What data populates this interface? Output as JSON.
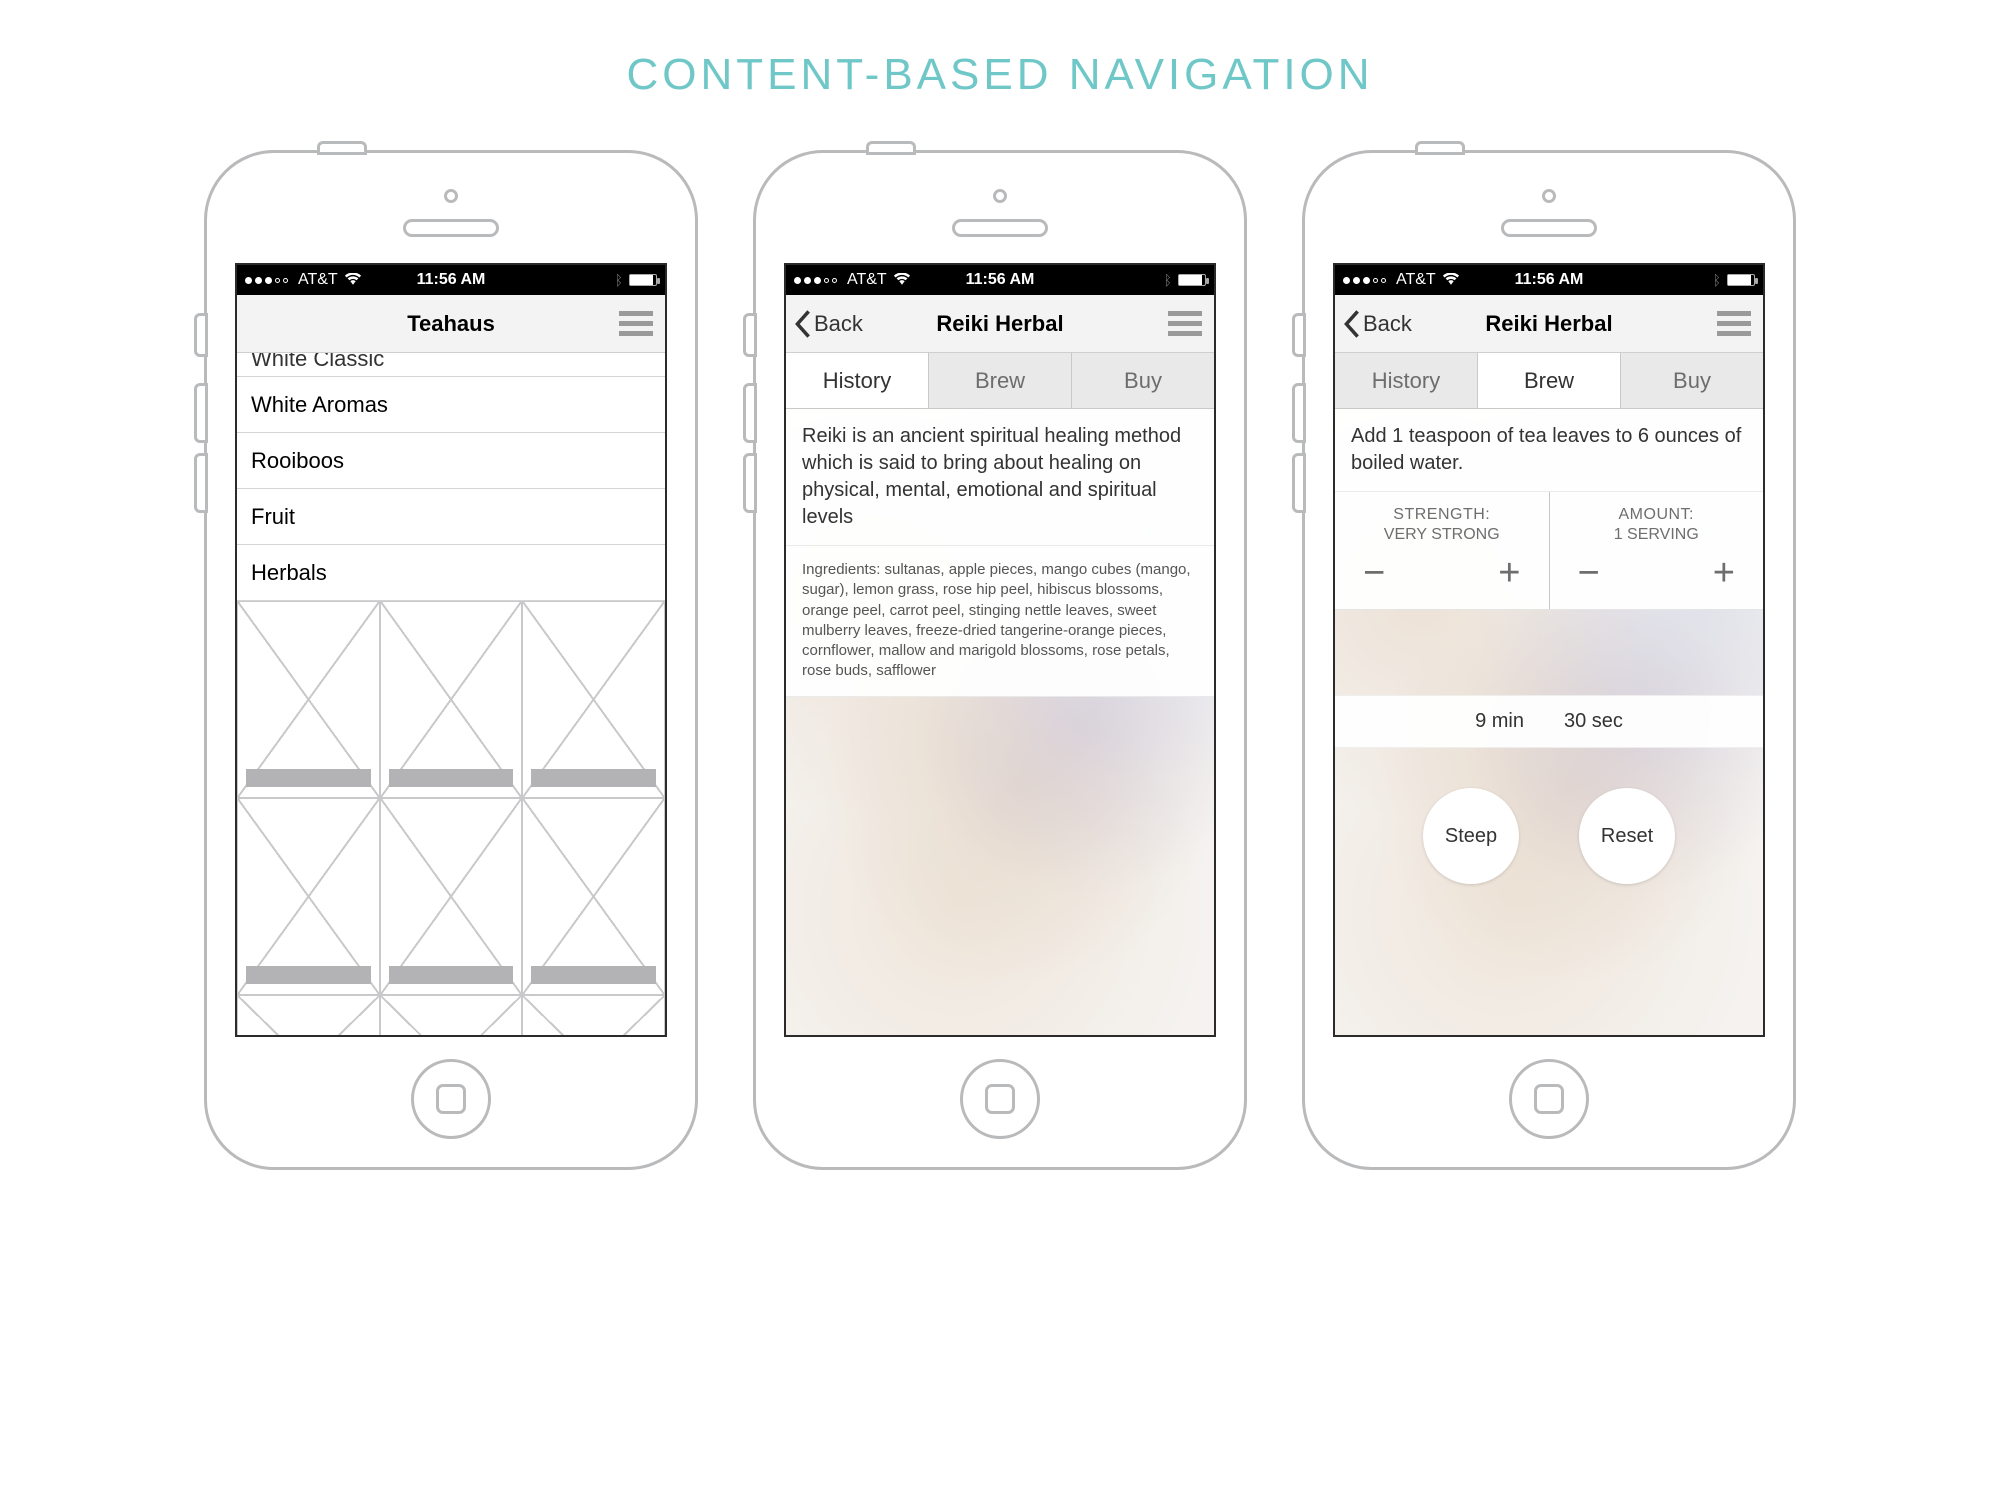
{
  "page_heading": "CONTENT-BASED NAVIGATION",
  "status": {
    "carrier": "AT&T",
    "time": "11:56 AM"
  },
  "phone1": {
    "title": "Teahaus",
    "list": {
      "partial_top": "White Classic",
      "items": [
        "White Aromas",
        "Rooiboos",
        "Fruit",
        "Herbals"
      ]
    }
  },
  "phone2": {
    "back_label": "Back",
    "title": "Reiki Herbal",
    "tabs": {
      "history": "History",
      "brew": "Brew",
      "buy": "Buy",
      "active": "history"
    },
    "description": "Reiki is an ancient spiritual healing method which is said to bring about healing on physical, mental, emotional and spiritual levels",
    "ingredients": "Ingredients: sultanas, apple pieces, mango cubes (mango, sugar), lemon grass, rose hip peel, hibiscus blossoms, orange peel, carrot peel, stinging nettle leaves, sweet mulberry leaves, freeze-dried tangerine-orange pieces, cornflower, mallow and marigold blossoms, rose petals, rose buds, safflower"
  },
  "phone3": {
    "back_label": "Back",
    "title": "Reiki Herbal",
    "tabs": {
      "history": "History",
      "brew": "Brew",
      "buy": "Buy",
      "active": "brew"
    },
    "instruction": "Add 1 teaspoon of tea leaves to 6 ounces of boiled water.",
    "strength": {
      "label": "STRENGTH:",
      "value": "VERY STRONG"
    },
    "amount": {
      "label": "AMOUNT:",
      "value": "1 SERVING"
    },
    "time": {
      "minutes": "9 min",
      "seconds": "30 sec"
    },
    "buttons": {
      "steep": "Steep",
      "reset": "Reset"
    }
  }
}
